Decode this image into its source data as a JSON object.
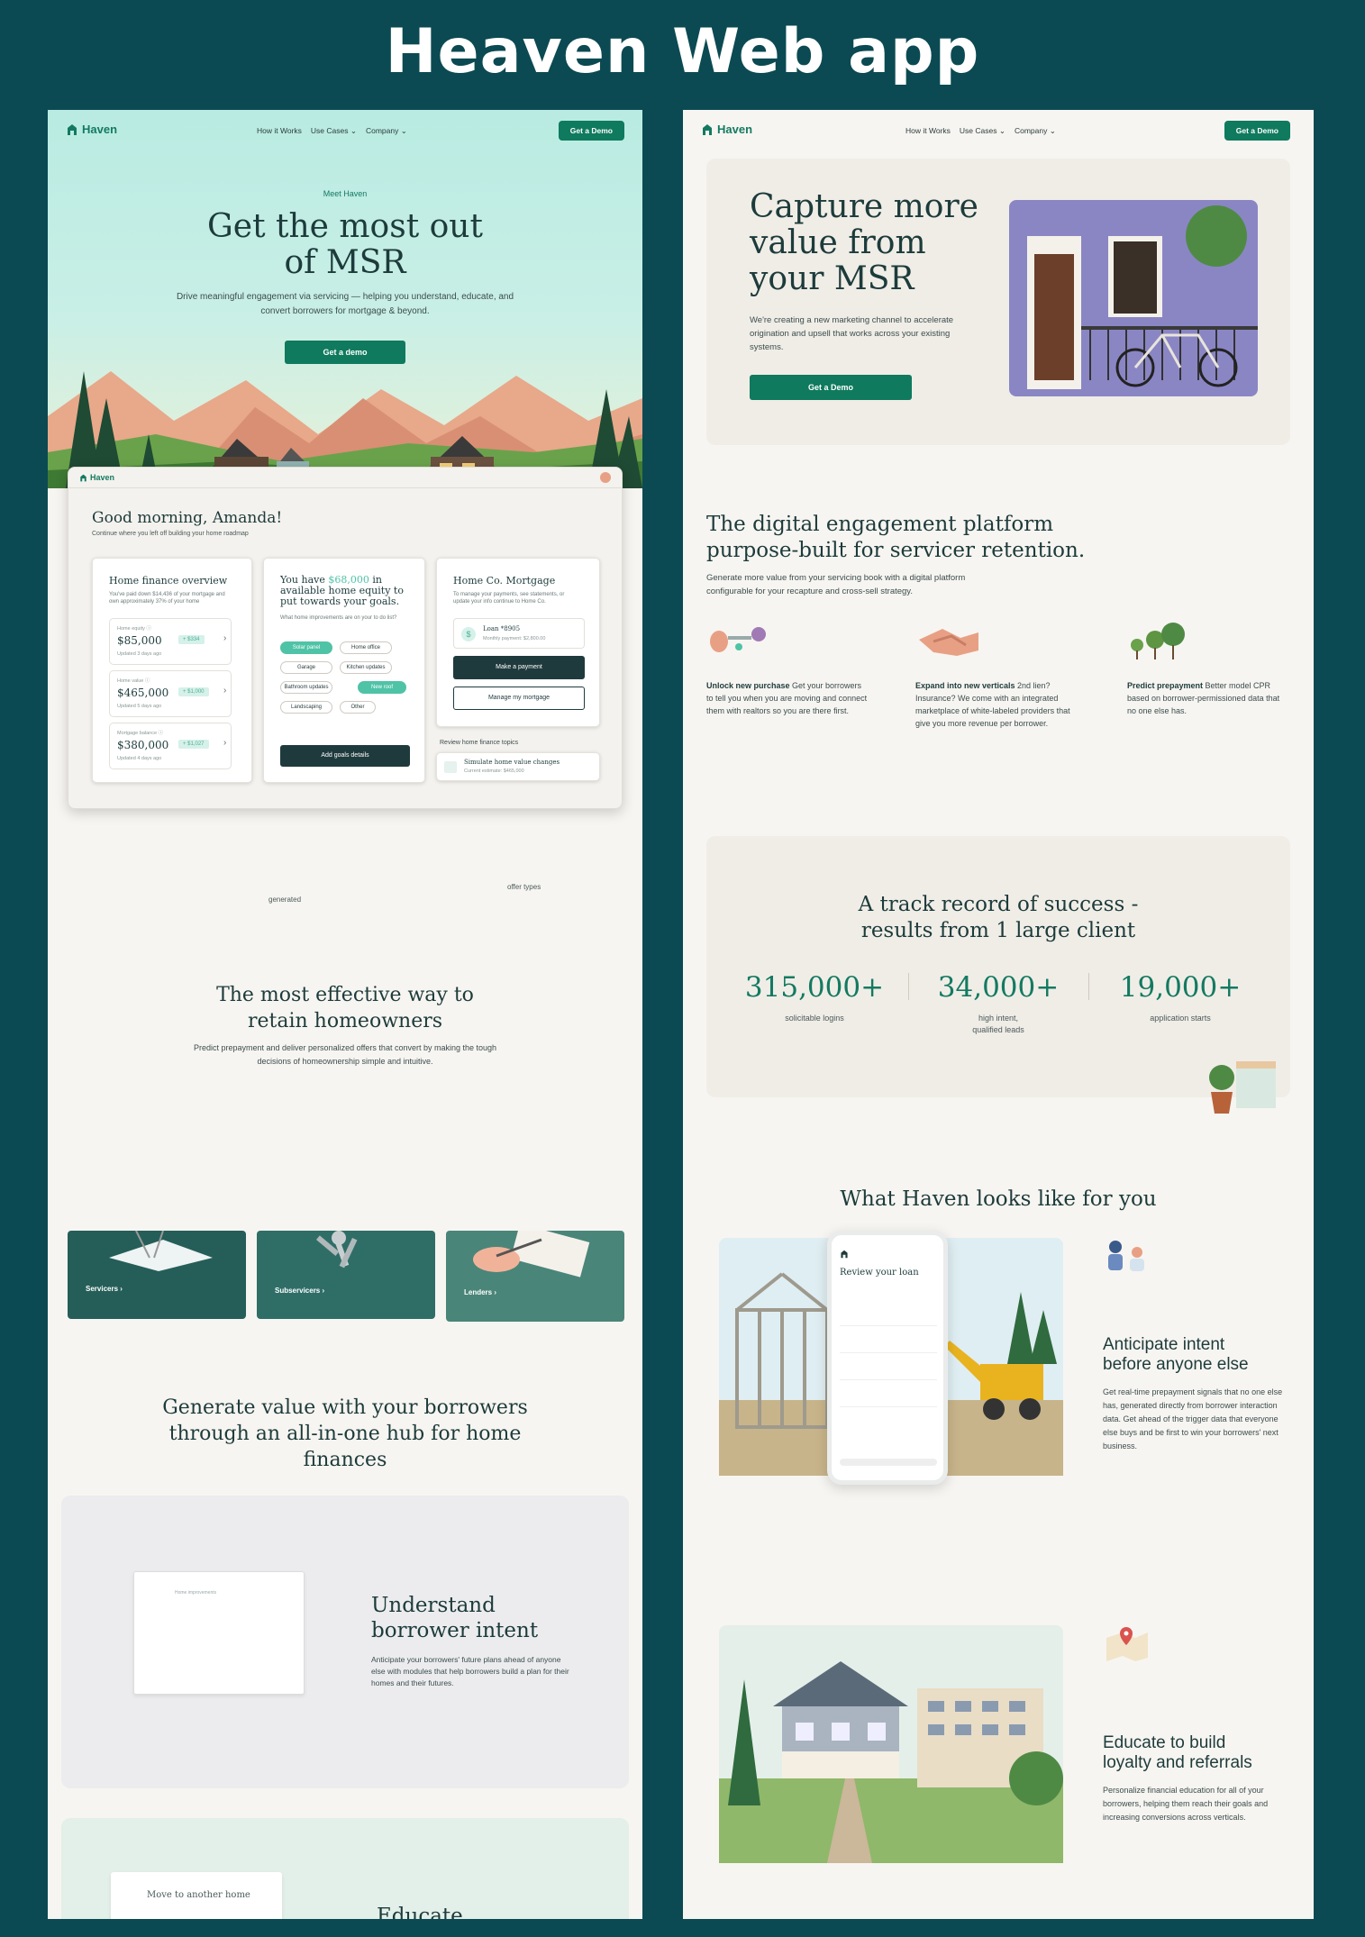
{
  "header": {
    "title": "Heaven Web app"
  },
  "left": {
    "brand": "Haven",
    "nav": [
      "How it Works",
      "Use Cases ⌄",
      "Company ⌄"
    ],
    "cta": "Get a Demo",
    "hero": {
      "eyebrow": "Meet Haven",
      "title": "Get the most out of MSR",
      "subtitle": "Drive meaningful engagement via servicing — helping you understand, educate, and convert borrowers for mortgage & beyond.",
      "button": "Get a demo"
    },
    "dashboard": {
      "brand": "Haven",
      "greeting": "Good morning, Amanda!",
      "greeting_sub": "Continue where you left off building your home roadmap",
      "overview": {
        "title": "Home finance overview",
        "desc": "You've paid down $14,436 of your mortgage and own approximately 37% of your home",
        "stats": [
          {
            "label": "Home equity ⓘ",
            "value": "$85,000",
            "delta": "+ $334",
            "updated": "Updated 3 days ago"
          },
          {
            "label": "Home value ⓘ",
            "value": "$465,000",
            "delta": "+ $1,000",
            "updated": "Updated 5 days ago"
          },
          {
            "label": "Mortgage balance ⓘ",
            "value": "$380,000",
            "delta": "+ $1,027",
            "updated": "Updated 4 days ago"
          }
        ]
      },
      "equity": {
        "title_pre": "You have ",
        "title_amount": "$68,000",
        "title_post": " in available home equity to put towards your goals.",
        "question": "What home improvements are on your to do list?",
        "pills": [
          "Solar panel",
          "Home office",
          "Garage",
          "Kitchen updates",
          "Bathroom updates",
          "New roof",
          "Landscaping",
          "Other"
        ],
        "button": "Add goals details"
      },
      "mortgage": {
        "title": "Home Co. Mortgage",
        "desc": "To manage your payments, see statements, or update your info continue to Home Co.",
        "loan": "Loan *8905",
        "loan_sub": "Monthly payment: $2,800.00",
        "pay_button": "Make a payment",
        "manage_button": "Manage my mortgage"
      },
      "topics": {
        "title": "Review home finance topics",
        "item": "Simulate home value changes",
        "item_sub": "Current estimate: $465,000"
      }
    },
    "cutoff": {
      "left": "generated",
      "right": "offer types"
    },
    "retain": {
      "title": "The most effective way to retain homeowners",
      "desc": "Predict prepayment and deliver personalized offers that convert by making the tough decisions of homeownership simple and intuitive."
    },
    "segments": [
      "Servicers ›",
      "Subservicers ›",
      "Lenders ›"
    ],
    "generate": {
      "title": "Generate value with your borrowers through an all-in-one hub for home finances"
    },
    "understand": {
      "title": "Understand borrower intent",
      "desc": "Anticipate your borrowers' future plans ahead of anyone else with modules that help borrowers build a plan for their homes and their futures.",
      "card_text": "Home improvements"
    },
    "educate": {
      "card_text": "Move to another home",
      "title": "Educate"
    }
  },
  "right": {
    "brand": "Haven",
    "nav": [
      "How it Works",
      "Use Cases ⌄",
      "Company ⌄"
    ],
    "cta": "Get a Demo",
    "hero": {
      "title": "Capture more value from your MSR",
      "desc": "We're creating a new marketing channel to accelerate origination and upsell that works across your existing systems.",
      "button": "Get a Demo"
    },
    "platform": {
      "title": "The digital engagement platform purpose-built for servicer retention.",
      "desc": "Generate more value from your servicing book with a digital platform configurable for your recapture and cross-sell strategy."
    },
    "features": [
      {
        "title": "Unlock new purchase",
        "text": " Get your borrowers to tell you when you are moving and connect them with realtors so you are there first."
      },
      {
        "title": "Expand into new verticals",
        "text": " 2nd lien? Insurance? We come with an integrated marketplace of white-labeled providers that give you more revenue per borrower."
      },
      {
        "title": "Predict prepayment",
        "text": " Better model CPR based on borrower-permissioned data that no one else has."
      }
    ],
    "track": {
      "title": "A track record of success - results from 1 large client",
      "stats": [
        {
          "value": "315,000+",
          "label": "solicitable logins"
        },
        {
          "value": "34,000+",
          "label": "high intent, qualified leads"
        },
        {
          "value": "19,000+",
          "label": "application starts"
        }
      ]
    },
    "looks": {
      "title": "What Haven looks like for you"
    },
    "phone": {
      "title": "Review your loan"
    },
    "anticipate": {
      "title": "Anticipate intent before anyone else",
      "desc": "Get real-time prepayment signals that no one else has, generated directly from borrower interaction data. Get ahead of the trigger data that everyone else buys and be first to win your borrowers' next business."
    },
    "educate": {
      "title": "Educate to build loyalty and referrals",
      "desc": "Personalize financial education for all of your borrowers, helping them reach their goals and increasing conversions across verticals."
    }
  },
  "colors": {
    "background": "#0b4a52",
    "brand_green": "#137a61",
    "button": "#0f7a5e",
    "mint": "#4fc3a6",
    "dark_button": "#1f3a3d",
    "panel": "#f7f5f1"
  }
}
